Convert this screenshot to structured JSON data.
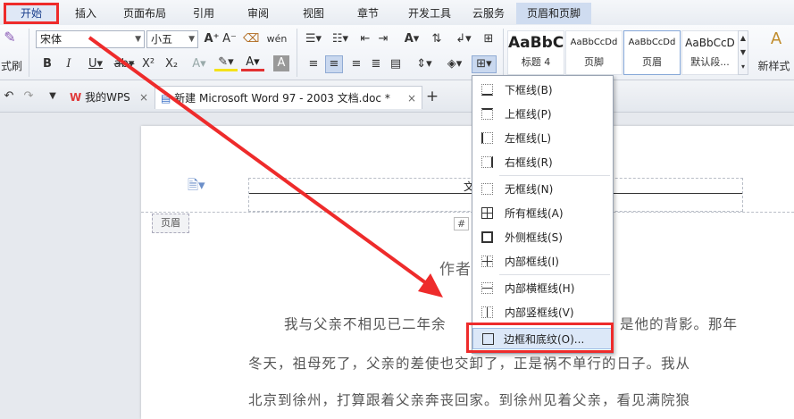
{
  "menubar": {
    "items": [
      "开始",
      "插入",
      "页面布局",
      "引用",
      "审阅",
      "视图",
      "章节",
      "开发工具",
      "云服务",
      "页眉和页脚"
    ]
  },
  "ribbon": {
    "format_painter_label": "式刷",
    "font_name": "宋体",
    "font_size": "小五",
    "styles": [
      {
        "sample": "AaBbC",
        "name": "标题 4"
      },
      {
        "sample": "AaBbCcDd",
        "name": "页脚"
      },
      {
        "sample": "AaBbCcDd",
        "name": "页眉"
      },
      {
        "sample": "AaBbCcD",
        "name": "默认段..."
      }
    ],
    "new_style_label": "新样式"
  },
  "tabs": {
    "home": "我的WPS",
    "doc": "新建 Microsoft Word 97 - 2003 文档.doc *",
    "new_tab": "+"
  },
  "document": {
    "header_tag": "页眉",
    "header_fragment": "文",
    "author_fragment": "作者",
    "hash_fragment": "#",
    "lines": [
      "我与父亲不相见已二年余",
      "是他的背影。那年",
      "冬天，祖母死了，父亲的差使也交卸了，正是祸不单行的日子。我从",
      "北京到徐州，打算跟着父亲奔丧回家。到徐州见着父亲，看见满院狼"
    ]
  },
  "dropdown": {
    "items": [
      "下框线(B)",
      "上框线(P)",
      "左框线(L)",
      "右框线(R)",
      "无框线(N)",
      "所有框线(A)",
      "外侧框线(S)",
      "内部框线(I)",
      "内部横框线(H)",
      "内部竖框线(V)",
      "边框和底纹(O)..."
    ]
  },
  "colors": {
    "annotation": "#ee2b2b",
    "accent": "#1f5fbf"
  }
}
